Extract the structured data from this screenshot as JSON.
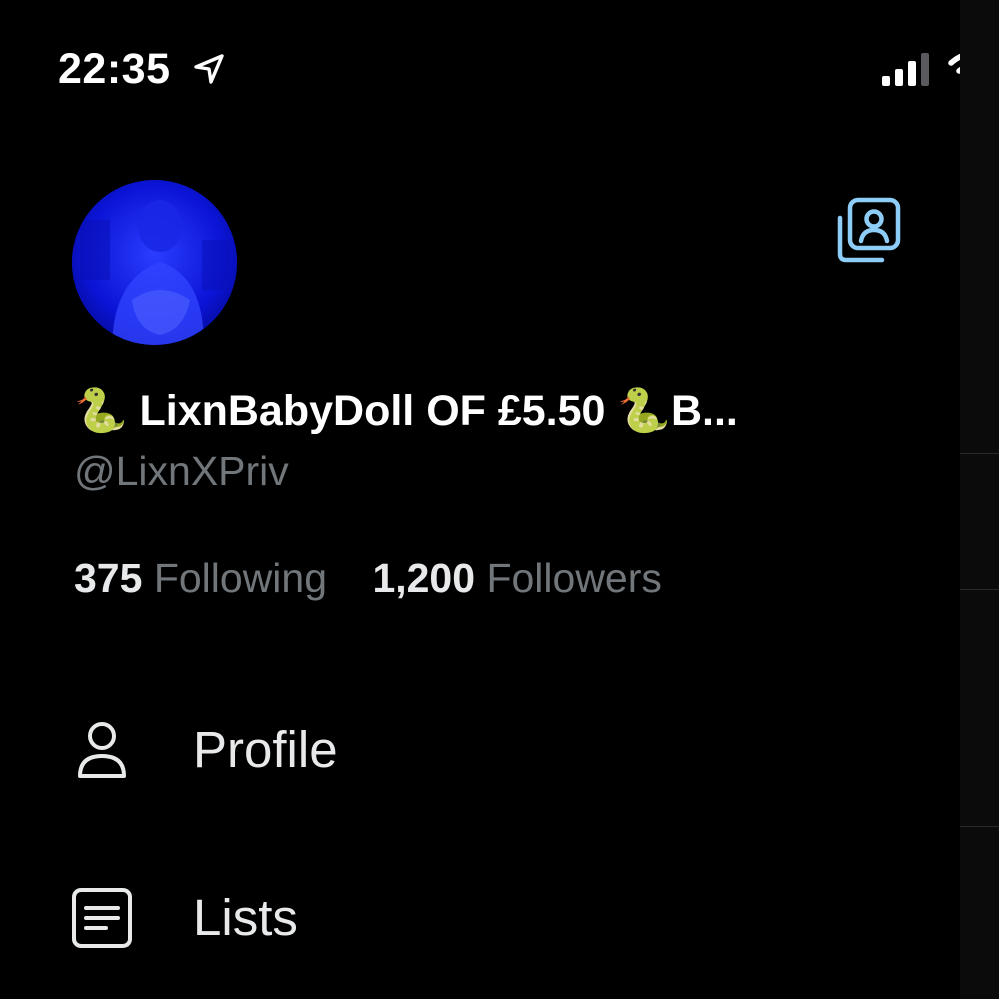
{
  "status_bar": {
    "time": "22:35",
    "location_icon": "location-arrow-icon",
    "signal_icon": "cellular-signal-icon",
    "wifi_icon": "wifi-icon"
  },
  "profile": {
    "display_name": "🐍 LixnBabyDoll OF £5.50 🐍B...",
    "handle": "@LixnXPriv",
    "avatar_icon": "avatar",
    "accounts_icon": "switch-accounts-icon",
    "following_count": "375",
    "following_label": "Following",
    "followers_count": "1,200",
    "followers_label": "Followers"
  },
  "menu": {
    "items": [
      {
        "label": "Profile",
        "icon": "person-icon"
      },
      {
        "label": "Lists",
        "icon": "list-document-icon"
      }
    ]
  },
  "colors": {
    "background": "#000000",
    "primary_text": "#e7e9ea",
    "secondary_text": "#71767b",
    "accent": "#8ecdf8",
    "avatar_bg": "#0a12c8"
  }
}
